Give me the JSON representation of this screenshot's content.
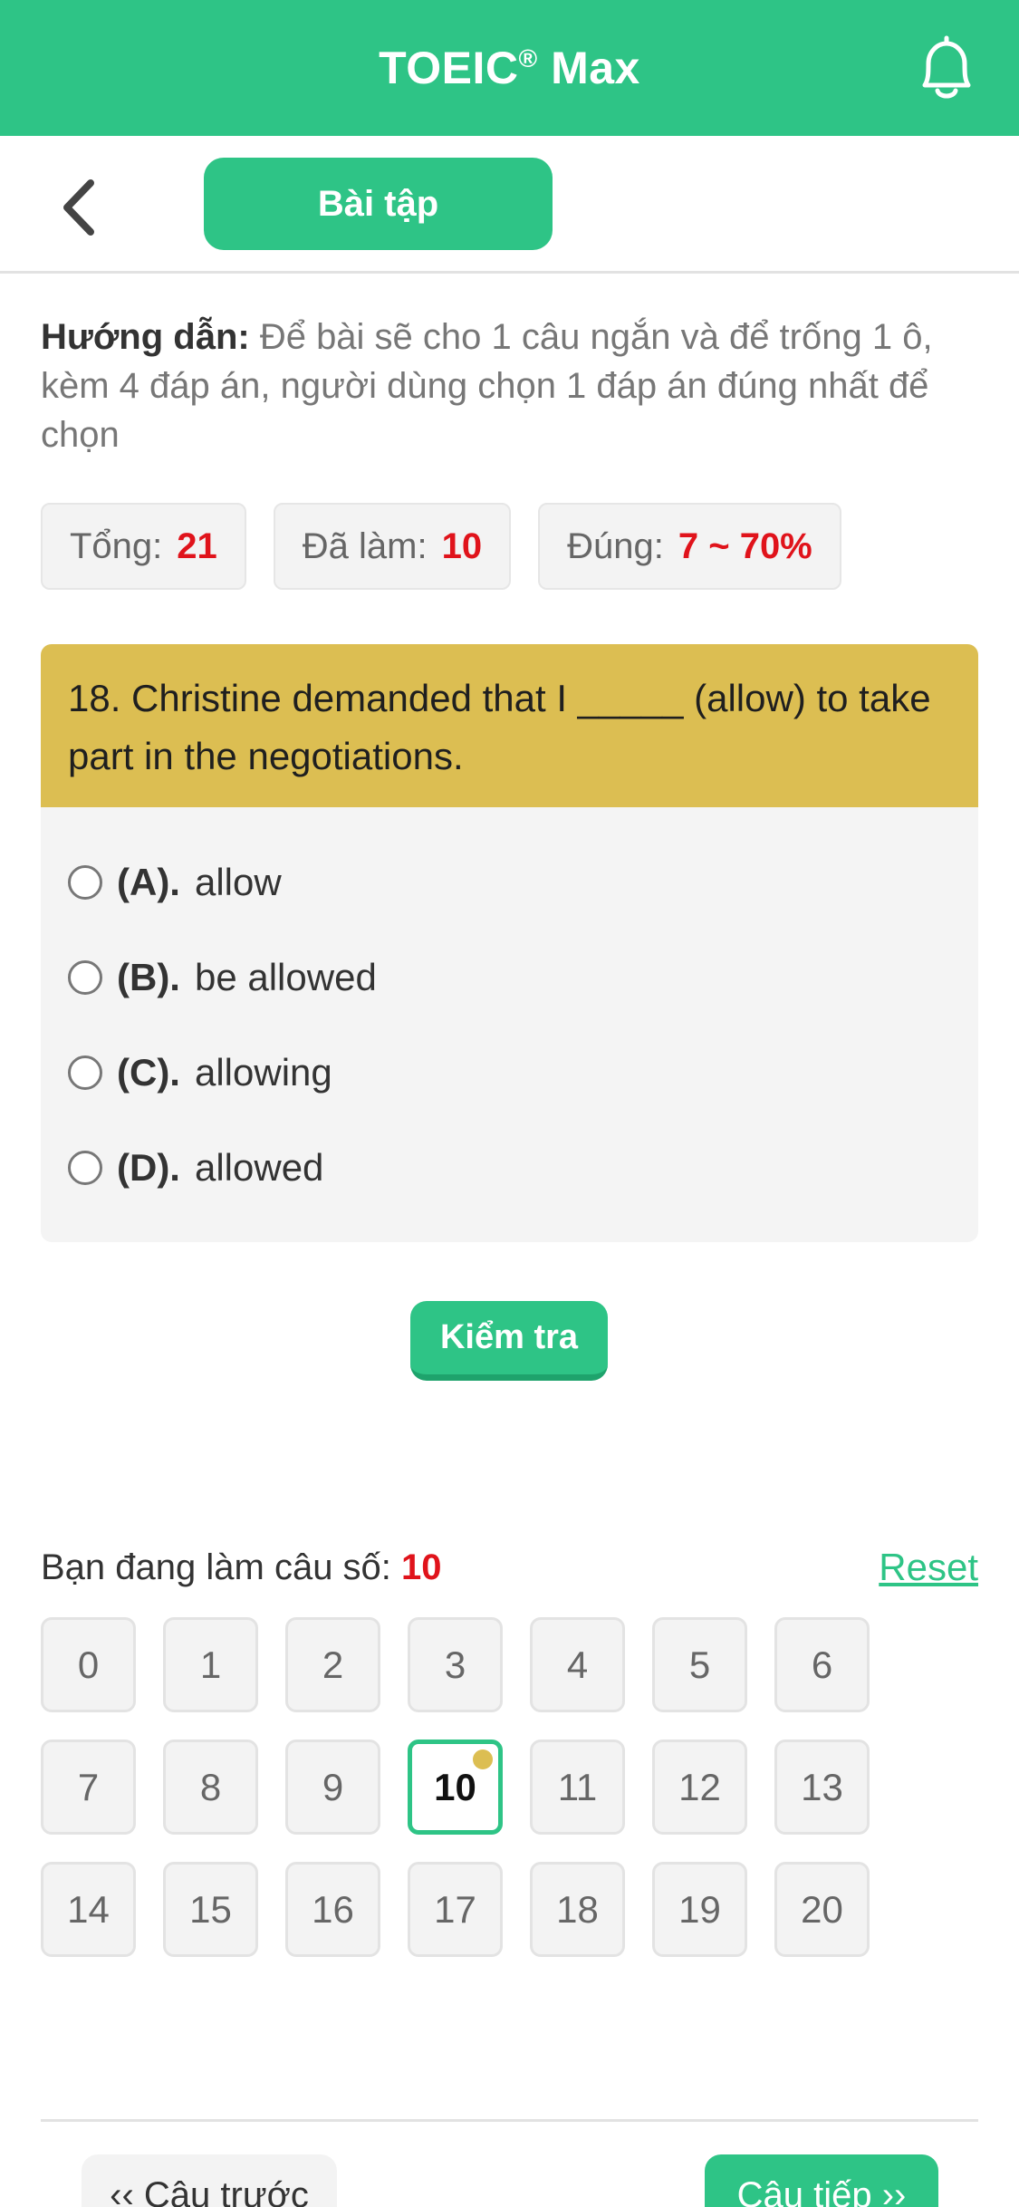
{
  "header": {
    "title": "TOEIC",
    "title_mark": "®",
    "title_suffix": " Max",
    "bell_icon": "bell-icon",
    "color": "#2ec486"
  },
  "subheader": {
    "back_icon": "chevron-left-icon",
    "tab_label": "Bài tập"
  },
  "instructions": {
    "label": "Hướng dẫn:",
    "text": " Để bài sẽ cho 1 câu ngắn và để trống 1 ô, kèm 4 đáp án, người dùng chọn 1 đáp án đúng nhất để chọn"
  },
  "stats": {
    "total_label": "Tổng:",
    "total_value": "21",
    "done_label": "Đã làm:",
    "done_value": "10",
    "correct_label": "Đúng:",
    "correct_value": "7 ~ 70%"
  },
  "question": {
    "text": "18. Christine demanded that I _____ (allow) to take part in the negotiations.",
    "options": [
      {
        "letter": "(A).",
        "text": "allow"
      },
      {
        "letter": "(B).",
        "text": "be allowed"
      },
      {
        "letter": "(C).",
        "text": "allowing"
      },
      {
        "letter": "(D).",
        "text": "allowed"
      }
    ],
    "card_color": "#dcbe52"
  },
  "check_button": "Kiểm tra",
  "progress": {
    "label": "Bạn đang làm câu số:",
    "current": "10",
    "reset_label": "Reset"
  },
  "grid": {
    "numbers": [
      "0",
      "1",
      "2",
      "3",
      "4",
      "5",
      "6",
      "7",
      "8",
      "9",
      "10",
      "11",
      "12",
      "13",
      "14",
      "15",
      "16",
      "17",
      "18",
      "19",
      "20"
    ],
    "current_index": 10
  },
  "footer": {
    "prev_label": "‹‹ Câu trước",
    "next_label": "Câu tiếp ››"
  }
}
